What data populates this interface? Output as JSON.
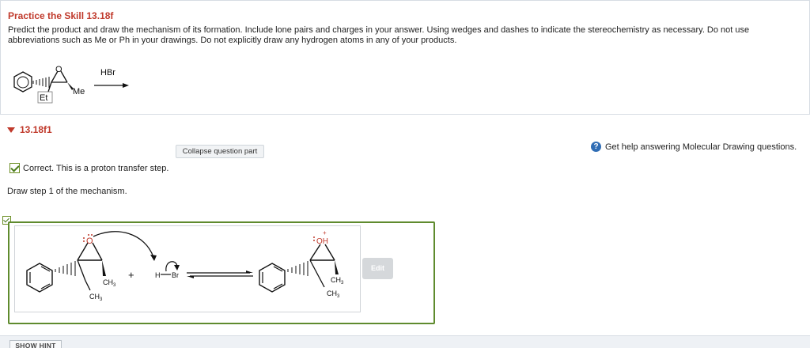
{
  "problem": {
    "title": "Practice the Skill 13.18f",
    "text": "Predict the product and draw the mechanism of its formation. Include lone pairs and charges in your answer. Using wedges and dashes to indicate the stereochemistry as necessary. Do not use abbreviations such as Me or Ph in your drawings. Do not explicitly draw any hydrogen atoms in any of your products.",
    "reaction": {
      "o_label": "O",
      "et_label": "Et",
      "me_label": "Me",
      "reagent": "HBr"
    }
  },
  "part": {
    "label": "13.18f1",
    "collapse_label": "Collapse question part",
    "help_label": "Get help answering Molecular Drawing questions.",
    "feedback": "Correct. This is a proton transfer step.",
    "instruction": "Draw step 1 of the mechanism.",
    "edit_label": "Edit",
    "hint_label": "SHOW HINT"
  },
  "mechanism": {
    "epoxide_o": "O",
    "ch3_a": "CH",
    "ch3_b": "CH",
    "sub3": "3",
    "plus": "+",
    "h": "H",
    "br": "Br",
    "oh": "OH",
    "plus_charge": "+"
  },
  "colors": {
    "title_red": "#c0392b",
    "correct_green": "#5f8b2e",
    "help_blue": "#2f6db5"
  },
  "icons": [
    "check-icon",
    "help-icon",
    "collapse-triangle-icon",
    "curved-arrow-icon"
  ]
}
